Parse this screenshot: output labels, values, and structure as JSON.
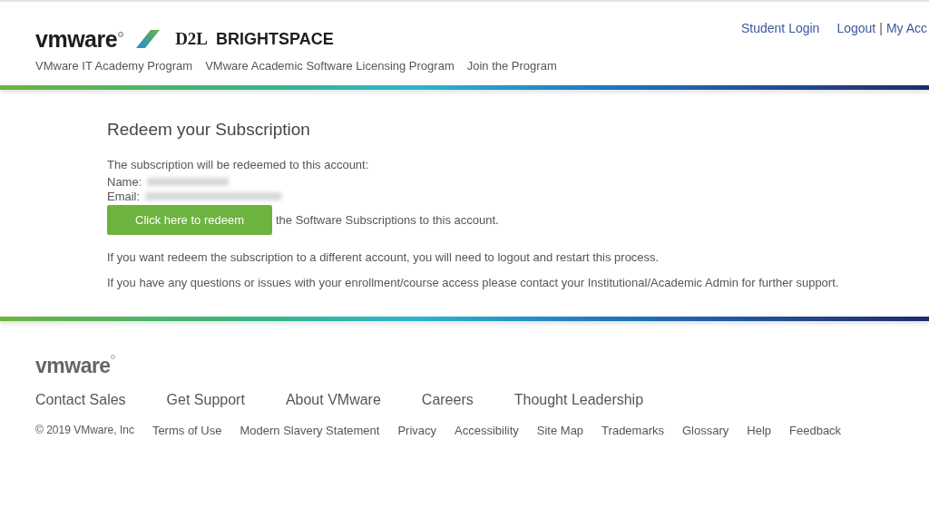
{
  "header": {
    "logo_text": "vmware",
    "partner_logo": {
      "mark": "D2L",
      "name": "BRIGHTSPACE"
    },
    "top_links": [
      "Student Login",
      "Logout",
      "My Acc"
    ],
    "link_separator": "|",
    "nav": [
      "VMware IT Academy Program",
      "VMware Academic Software Licensing Program",
      "Join the Program"
    ]
  },
  "content": {
    "title": "Redeem your Subscription",
    "intro": "The subscription will be redeemed to this account:",
    "fields": [
      {
        "label": "Name:",
        "kind": "redacted"
      },
      {
        "label": "Email:",
        "kind": "redacted"
      }
    ],
    "redeem_button": "Click here to redeem",
    "button_suffix": "the Software Subscriptions to this account.",
    "paragraphs": [
      "If you want redeem the subscription to a different account, you will need to logout and restart this process.",
      "If you have any questions or issues with your enrollment/course access please contact your Institutional/Academic Admin for further support."
    ]
  },
  "footer": {
    "logo_text": "vmware",
    "main_links": [
      "Contact Sales",
      "Get Support",
      "About VMware",
      "Careers",
      "Thought Leadership"
    ],
    "copyright": "© 2019 VMware, Inc",
    "legal_links": [
      "Terms of Use",
      "Modern Slavery Statement",
      "Privacy",
      "Accessibility",
      "Site Map",
      "Trademarks",
      "Glossary",
      "Help",
      "Feedback"
    ]
  }
}
